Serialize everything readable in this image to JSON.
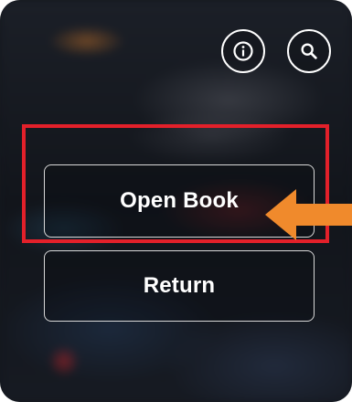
{
  "header": {
    "info_icon": "info-icon",
    "search_icon": "search-icon"
  },
  "menu": {
    "open_book_label": "Open Book",
    "return_label": "Return"
  },
  "annotation": {
    "highlight_color": "#e3202a",
    "arrow_color": "#f08a2c"
  }
}
